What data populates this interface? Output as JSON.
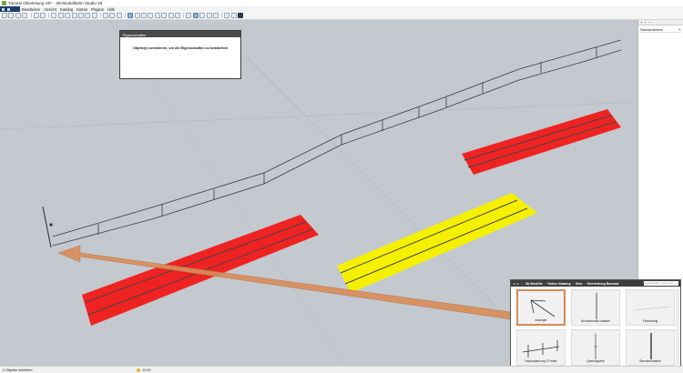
{
  "window": {
    "title": "Tutorial Oberleitung H0* - 3D-Modellbahn Studio V6"
  },
  "menu": {
    "items": [
      "Bearbeiten",
      "Ansicht",
      "Katalog",
      "Extras",
      "Plugins",
      "Hilfe"
    ]
  },
  "properties": {
    "header": "Eigenschaften",
    "message": "Objekt(e) selektieren, um die Eigenschaften zu bearbeiten"
  },
  "layers": {
    "item": "Standardebene"
  },
  "catalog": {
    "breadcrumb": [
      "3D-Modelle",
      "Online-Katalog",
      "Sets",
      "Oberleitung Bausatz"
    ],
    "search_placeholder": "Suchbegriff (-Lorem ip)",
    "items": [
      {
        "label": "Ausleger",
        "icon": "ausleger-icon"
      },
      {
        "label": "Brückenmast variabel",
        "icon": "mast-variable-icon"
      },
      {
        "label": "Fahrleitung",
        "icon": "fahrleitung-icon"
      },
      {
        "label": "Nachspannung 3 Felder",
        "icon": "nachspannung-icon"
      },
      {
        "label": "Quertragwerk",
        "icon": "quertragwerk-icon"
      },
      {
        "label": "Streckenmasten",
        "icon": "streckenmast-icon"
      }
    ]
  },
  "status": {
    "selection": "0 Objekte selektiert",
    "time": "12:00"
  },
  "colors": {
    "track_red": "#ef2222",
    "track_yellow": "#f4f000",
    "arrow": "#d98e5c",
    "viewport_bg": "#c3c9cf"
  }
}
